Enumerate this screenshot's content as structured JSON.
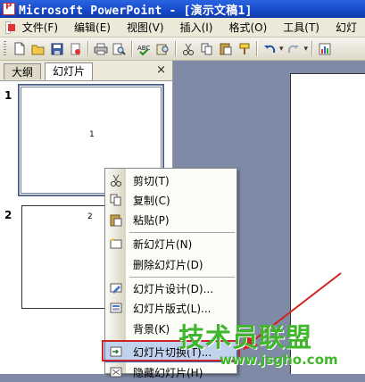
{
  "window": {
    "title": "Microsoft PowerPoint - [演示文稿1]"
  },
  "menubar": {
    "items": [
      "文件(F)",
      "编辑(E)",
      "视图(V)",
      "插入(I)",
      "格式(O)",
      "工具(T)",
      "幻灯"
    ]
  },
  "toolbar": {
    "undo_arrow": "▾",
    "redo_arrow": "▾"
  },
  "pane": {
    "tabs": [
      "大纲",
      "幻灯片"
    ],
    "close": "×",
    "slides": [
      {
        "number": "1",
        "label": "1"
      },
      {
        "number": "2",
        "label": "2"
      }
    ]
  },
  "context_menu": {
    "items": [
      {
        "label": "剪切(T)",
        "icon": "scissors-icon"
      },
      {
        "label": "复制(C)",
        "icon": "copy-icon"
      },
      {
        "label": "粘贴(P)",
        "icon": "paste-icon"
      },
      {
        "label": "新幻灯片(N)",
        "icon": "new-slide-icon"
      },
      {
        "label": "删除幻灯片(D)",
        "icon": ""
      },
      {
        "label": "幻灯片设计(D)...",
        "icon": "slide-design-icon"
      },
      {
        "label": "幻灯片版式(L)...",
        "icon": "slide-layout-icon"
      },
      {
        "label": "背景(K)",
        "icon": ""
      },
      {
        "label": "幻灯片切换(T)...",
        "icon": "slide-transition-icon"
      },
      {
        "label": "隐藏幻灯片(H)",
        "icon": "hide-slide-icon"
      }
    ]
  },
  "watermark": {
    "main": "技术员联盟",
    "url": "www.jsgho.com"
  },
  "colors": {
    "title_bar": "#1548c8",
    "menu_bg": "#ece9d8",
    "highlight": "#c1d2ee",
    "annotation_red": "#d02424",
    "watermark_green": "#3fb62c"
  }
}
